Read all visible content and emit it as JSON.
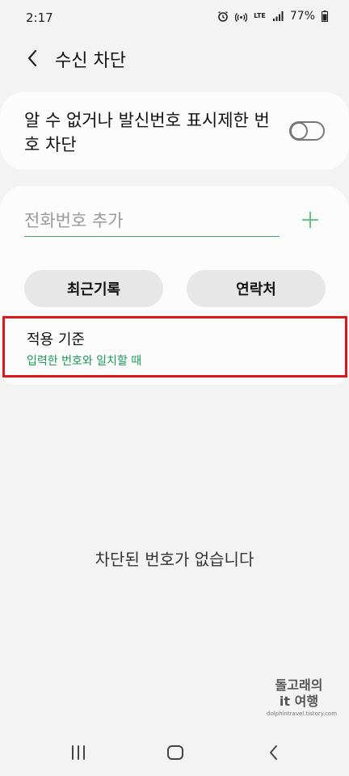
{
  "status_bar": {
    "time": "2:17",
    "battery": "77%",
    "network_label": "LTE"
  },
  "header": {
    "title": "수신 차단"
  },
  "unknown_toggle": {
    "label": "알 수 없거나 발신번호 표시제한 번호 차단",
    "enabled": false
  },
  "add_number": {
    "placeholder": "전화번호 추가"
  },
  "buttons": {
    "recent_label": "최근기록",
    "contacts_label": "연락처"
  },
  "criteria": {
    "title": "적용 기준",
    "value": "입력한 번호와 일치할 때"
  },
  "empty_message": "차단된 번호가 없습니다",
  "watermark": {
    "line1": "돌고래의",
    "line2": "it 여행",
    "url": "dolphintravel.tistory.com"
  },
  "colors": {
    "accent_green": "#199a55",
    "highlight_red": "#e0161b",
    "background": "#f3f3f3"
  }
}
